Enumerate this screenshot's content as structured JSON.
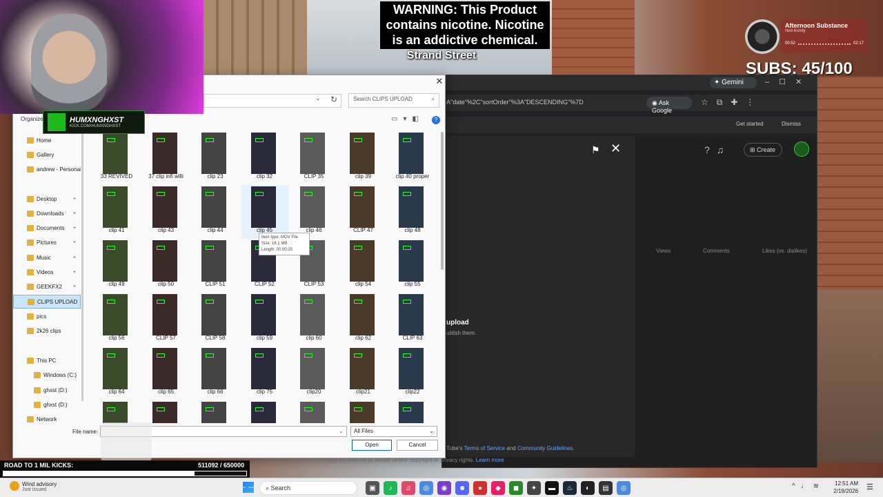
{
  "overlay": {
    "warning": "WARNING: This Product contains nicotine. Nicotine is an addictive chemical.",
    "street": "Strand Street",
    "streamer_logo_name": "HUMXNGHXST",
    "streamer_logo_sub": "KICK.COM/HUMXNGHXST",
    "now_playing": {
      "title": "Afternoon Substance",
      "artist": "Ned Bundy",
      "elapsed": "00:52",
      "total": "02:17"
    },
    "subs": "SUBS: 45/100",
    "kicks": {
      "label": "ROAD TO 1 MIL KICKS:",
      "value_text": "511092  /  650000",
      "current": 511092,
      "goal": 650000
    }
  },
  "browser": {
    "gemini_label": "✦ Gemini",
    "url_fragment": "A\"date\"%2C\"sortOrder\"%3A\"DESCENDING\"%7D",
    "ask_google": "Ask Google",
    "get_started": "Get started",
    "dismiss": "Dismiss",
    "create_label": "Create",
    "columns": {
      "views": "Views",
      "comments": "Comments",
      "likes": "Likes (vs. dislikes)"
    },
    "upload_title": "upload",
    "upload_sub": "ublish them.",
    "tos_prefix": "Tube's",
    "tos_link": "Terms of Service",
    "tos_and": "and",
    "tos_link2": "Community Guidelines.",
    "privacy_prefix": "Please be sure not to violate others' copyright or privacy rights.",
    "learn_more": "Learn more"
  },
  "dialog": {
    "search_placeholder": "Search CLIPS UPLOAD",
    "organize": "Organize",
    "nav": [
      {
        "label": "Home",
        "icon": "home-icon"
      },
      {
        "label": "Gallery",
        "icon": "gallery-icon"
      },
      {
        "label": "andrew - Personal",
        "icon": "cloud-icon"
      },
      {
        "label": "Desktop",
        "icon": "desktop-icon",
        "pinned": true
      },
      {
        "label": "Downloads",
        "icon": "download-icon",
        "pinned": true
      },
      {
        "label": "Documents",
        "icon": "documents-icon",
        "pinned": true
      },
      {
        "label": "Pictures",
        "icon": "pictures-icon",
        "pinned": true
      },
      {
        "label": "Music",
        "icon": "music-icon",
        "pinned": true
      },
      {
        "label": "Videos",
        "icon": "videos-icon",
        "pinned": true
      },
      {
        "label": "GEEKFX2",
        "icon": "folder-icon",
        "pinned": true
      },
      {
        "label": "CLIPS UPLOAD",
        "icon": "folder-icon",
        "selected": true
      },
      {
        "label": "pics",
        "icon": "folder-icon"
      },
      {
        "label": "2k26 clips",
        "icon": "folder-icon"
      },
      {
        "label": "This PC",
        "icon": "pc-icon"
      },
      {
        "label": "Windows (C:)",
        "icon": "drive-icon"
      },
      {
        "label": "ghxst (D:)",
        "icon": "drive-icon"
      },
      {
        "label": "ghxst (D:)",
        "icon": "drive-icon"
      },
      {
        "label": "Network",
        "icon": "network-icon"
      }
    ],
    "files": [
      "33 REVIVED",
      "37 clip infi willi",
      "clip 23",
      "clip 32",
      "CLIP 35",
      "clip 39",
      "clip 40 proper",
      "clip 41",
      "clip 43",
      "clip 44",
      "clip 45",
      "clip 46",
      "CLIP 47",
      "clip 48",
      "clip 49",
      "clip 50",
      "CLIP 51",
      "CLIP 52",
      "CLIP 53",
      "clip 54",
      "clip 55",
      "clip 56",
      "CLIP 57",
      "CLIP 58",
      "clip 59",
      "clip 60",
      "clip 62",
      "CLIP 63",
      "clip 64",
      "clip 65",
      "clip 66",
      "clip 75",
      "clip20",
      "clip21",
      "clip22",
      "",
      "",
      "",
      "",
      "",
      "",
      ""
    ],
    "tooltip": {
      "type": "Item type: MOV File",
      "size": "Size: 16.1 MB",
      "length": "Length: 00:00:25"
    },
    "file_name_label": "File name:",
    "file_name_value": "",
    "file_type": "All Files",
    "open": "Open",
    "cancel": "Cancel"
  },
  "taskbar": {
    "weather_title": "Wind advisory",
    "weather_sub": "Just issued",
    "search": "Search",
    "time": "12:51 AM",
    "date": "2/19/2026"
  }
}
